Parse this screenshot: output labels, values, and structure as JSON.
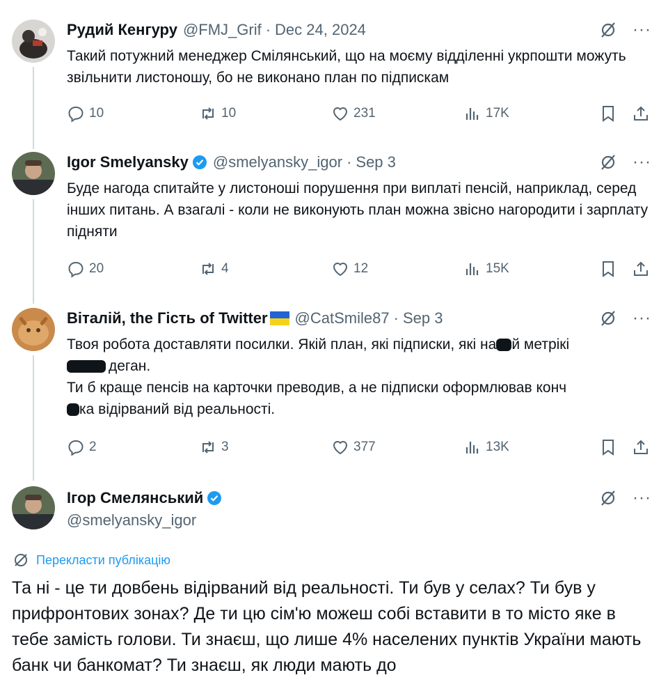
{
  "tweets": [
    {
      "name": "Рудий Кенгуру",
      "handle": "@FMJ_Grif",
      "date": "Dec 24, 2024",
      "text": "Такий потужний менеджер Смілянський, що на моєму відділенні укрпошти можуть звільнити листоношу, бо не виконано план по підпискам",
      "replies": "10",
      "reposts": "10",
      "likes": "231",
      "views": "17K"
    },
    {
      "name": "Igor Smelyansky",
      "handle": "@smelyansky_igor",
      "date": "Sep 3",
      "text": "Буде нагода спитайте у листоноші порушення при виплаті пенсій, наприклад, серед інших питань. А взагалі - коли не виконують план можна звісно нагородити і зарплату підняти",
      "replies": "20",
      "reposts": "4",
      "likes": "12",
      "views": "15K"
    },
    {
      "name": "Віталій, the Гість of Twitter",
      "handle": "@CatSmile87",
      "date": "Sep 3",
      "text_line1_a": "Твоя робота доставляти посилки. Якій план, які підписки, які на",
      "text_line1_b": "й метрікі",
      "text_line2": "деган.",
      "text_line3": "Ти б краще пенсів на карточки преводив, а не підписки оформлював конч",
      "text_line4": "ка відірваний від реальності.",
      "replies": "2",
      "reposts": "3",
      "likes": "377",
      "views": "13K"
    }
  ],
  "main_tweet": {
    "name": "Ігор Смелянський",
    "handle": "@smelyansky_igor",
    "translate_label": "Перекласти публікацію",
    "text": "Та ні - це ти довбень відірваний від реальності. Ти був у селах? Ти був у прифронтових зонах? Де ти цю сім'ю можеш собі вставити в то місто яке в тебе замість голови. Ти знаєш, що лише 4% населених пунктів України мають банк чи банкомат? Ти знаєш, як люди мають до"
  },
  "separator": "·",
  "more_symbol": "···",
  "colors": {
    "verified": "#1d9bf0",
    "link": "#1d9bf0",
    "muted": "#536471",
    "thread_line": "#cfd9de",
    "flag_blue": "#1f63d6",
    "flag_yellow": "#f7d117"
  },
  "icons": [
    "reply-icon",
    "repost-icon",
    "like-icon",
    "views-icon",
    "bookmark-icon",
    "share-icon",
    "grok-icon",
    "more-icon",
    "verified-badge-icon",
    "translate-globe-icon"
  ]
}
